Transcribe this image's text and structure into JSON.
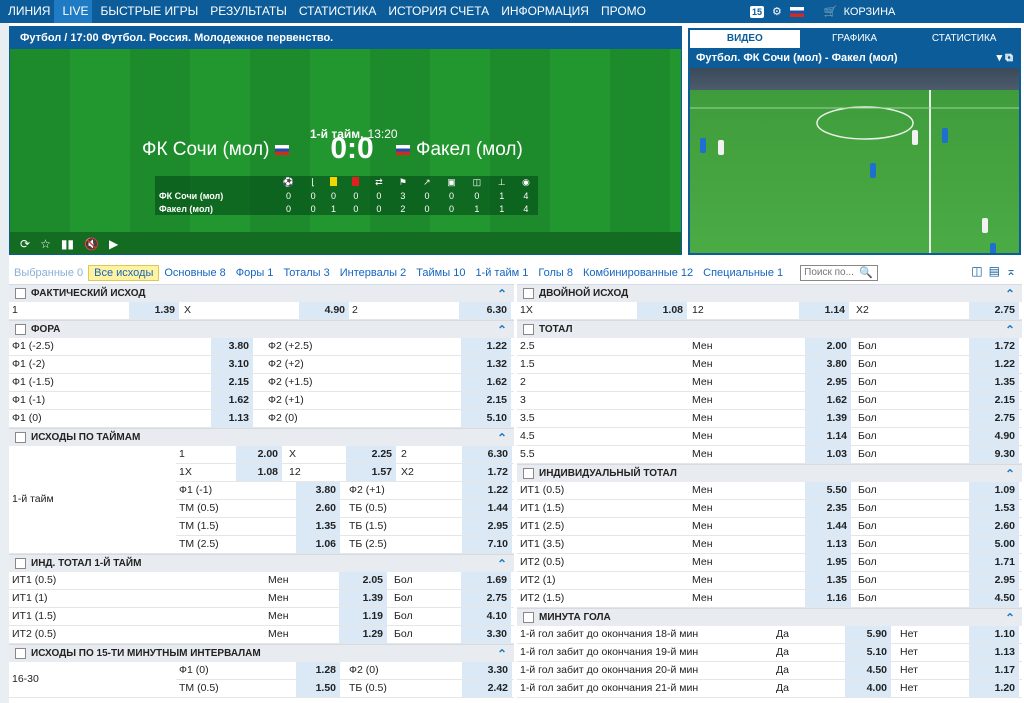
{
  "nav": {
    "items": [
      "ЛИНИЯ",
      "LIVE",
      "БЫСТРЫЕ ИГРЫ",
      "РЕЗУЛЬТАТЫ",
      "СТАТИСТИКА",
      "ИСТОРИЯ СЧЕТА",
      "ИНФОРМАЦИЯ",
      "ПРОМО"
    ],
    "badge": "15",
    "cart": "КОРЗИНА"
  },
  "match": {
    "breadcrumb": "Футбол  /  17:00 Футбол. Россия. Молодежное первенство.",
    "half": "1-й тайм,",
    "time": "13:20",
    "home": "ФК Сочи (мол)",
    "away": "Факел (мол)",
    "score": "0:0",
    "stats": [
      {
        "name": "ФК Сочи (мол)",
        "values": [
          "0",
          "0",
          "0",
          "0",
          "0",
          "3",
          "0",
          "0",
          "0",
          "1",
          "4"
        ]
      },
      {
        "name": "Факел (мол)",
        "values": [
          "0",
          "0",
          "1",
          "0",
          "0",
          "2",
          "0",
          "0",
          "1",
          "1",
          "4"
        ]
      }
    ]
  },
  "video": {
    "tabs": [
      "ВИДЕО",
      "ГРАФИКА",
      "СТАТИСТИКА"
    ],
    "title": "Футбол. ФК Сочи (мол) - Факел (мол)"
  },
  "tabs": [
    "Выбранные 0",
    "Все исходы",
    "Основные 8",
    "Форы 1",
    "Тоталы 3",
    "Интервалы 2",
    "Таймы 10",
    "1-й тайм 1",
    "Голы 8",
    "Комбинированные 12",
    "Специальные 1"
  ],
  "search_placeholder": "Поиск по...",
  "left": {
    "fakt": {
      "title": "ФАКТИЧЕСКИЙ ИСХОД",
      "row": [
        "1",
        "1.39",
        "Х",
        "4.90",
        "2",
        "6.30"
      ]
    },
    "fora": {
      "title": "ФОРА",
      "rows": [
        [
          "Ф1 (-2.5)",
          "3.80",
          "Ф2 (+2.5)",
          "1.22"
        ],
        [
          "Ф1 (-2)",
          "3.10",
          "Ф2 (+2)",
          "1.32"
        ],
        [
          "Ф1 (-1.5)",
          "2.15",
          "Ф2 (+1.5)",
          "1.62"
        ],
        [
          "Ф1 (-1)",
          "1.62",
          "Ф2 (+1)",
          "2.15"
        ],
        [
          "Ф1 (0)",
          "1.13",
          "Ф2 (0)",
          "5.10"
        ]
      ]
    },
    "halves": {
      "title": "ИСХОДЫ ПО ТАЙМАМ",
      "label": "1-й тайм",
      "rows": [
        [
          "1",
          "2.00",
          "Х",
          "2.25",
          "2",
          "6.30"
        ],
        [
          "1X",
          "1.08",
          "12",
          "1.57",
          "X2",
          "1.72"
        ],
        [
          "Ф1 (-1)",
          "3.80",
          "Ф2 (+1)",
          "1.22"
        ],
        [
          "ТМ (0.5)",
          "2.60",
          "ТБ (0.5)",
          "1.44"
        ],
        [
          "ТМ (1.5)",
          "1.35",
          "ТБ (1.5)",
          "2.95"
        ],
        [
          "ТМ (2.5)",
          "1.06",
          "ТБ (2.5)",
          "7.10"
        ]
      ]
    },
    "indtotal1": {
      "title": "ИНД. ТОТАЛ 1-Й ТАЙМ",
      "rows": [
        [
          "ИТ1 (0.5)",
          "Мен",
          "2.05",
          "Бол",
          "1.69"
        ],
        [
          "ИТ1 (1)",
          "Мен",
          "1.39",
          "Бол",
          "2.75"
        ],
        [
          "ИТ1 (1.5)",
          "Мен",
          "1.19",
          "Бол",
          "4.10"
        ],
        [
          "ИТ2 (0.5)",
          "Мен",
          "1.29",
          "Бол",
          "3.30"
        ]
      ]
    },
    "intervals": {
      "title": "ИСХОДЫ ПО 15-ТИ МИНУТНЫМ ИНТЕРВАЛАМ",
      "label": "16-30",
      "rows": [
        [
          "Ф1 (0)",
          "1.28",
          "Ф2 (0)",
          "3.30"
        ],
        [
          "ТМ (0.5)",
          "1.50",
          "ТБ (0.5)",
          "2.42"
        ]
      ]
    }
  },
  "right": {
    "double": {
      "title": "ДВОЙНОЙ ИСХОД",
      "row": [
        "1X",
        "1.08",
        "12",
        "1.14",
        "X2",
        "2.75"
      ]
    },
    "total": {
      "title": "ТОТАЛ",
      "rows": [
        [
          "2.5",
          "Мен",
          "2.00",
          "Бол",
          "1.72"
        ],
        [
          "1.5",
          "Мен",
          "3.80",
          "Бол",
          "1.22"
        ],
        [
          "2",
          "Мен",
          "2.95",
          "Бол",
          "1.35"
        ],
        [
          "3",
          "Мен",
          "1.62",
          "Бол",
          "2.15"
        ],
        [
          "3.5",
          "Мен",
          "1.39",
          "Бол",
          "2.75"
        ],
        [
          "4.5",
          "Мен",
          "1.14",
          "Бол",
          "4.90"
        ],
        [
          "5.5",
          "Мен",
          "1.03",
          "Бол",
          "9.30"
        ]
      ]
    },
    "indtotal": {
      "title": "ИНДИВИДУАЛЬНЫЙ ТОТАЛ",
      "rows": [
        [
          "ИТ1 (0.5)",
          "Мен",
          "5.50",
          "Бол",
          "1.09"
        ],
        [
          "ИТ1 (1.5)",
          "Мен",
          "2.35",
          "Бол",
          "1.53"
        ],
        [
          "ИТ1 (2.5)",
          "Мен",
          "1.44",
          "Бол",
          "2.60"
        ],
        [
          "ИТ1 (3.5)",
          "Мен",
          "1.13",
          "Бол",
          "5.00"
        ],
        [
          "ИТ2 (0.5)",
          "Мен",
          "1.95",
          "Бол",
          "1.71"
        ],
        [
          "ИТ2 (1)",
          "Мен",
          "1.35",
          "Бол",
          "2.95"
        ],
        [
          "ИТ2 (1.5)",
          "Мен",
          "1.16",
          "Бол",
          "4.50"
        ]
      ]
    },
    "goalmin": {
      "title": "МИНУТА ГОЛА",
      "rows": [
        [
          "1-й гол забит до окончания 18-й мин",
          "Да",
          "5.90",
          "Нет",
          "1.10"
        ],
        [
          "1-й гол забит до окончания 19-й мин",
          "Да",
          "5.10",
          "Нет",
          "1.13"
        ],
        [
          "1-й гол забит до окончания 20-й мин",
          "Да",
          "4.50",
          "Нет",
          "1.17"
        ],
        [
          "1-й гол забит до окончания 21-й мин",
          "Да",
          "4.00",
          "Нет",
          "1.20"
        ]
      ]
    }
  }
}
